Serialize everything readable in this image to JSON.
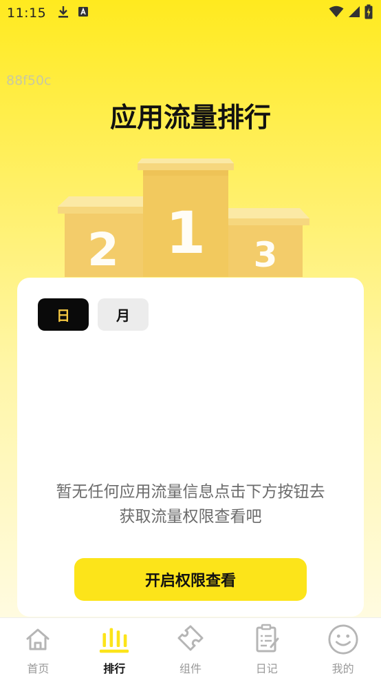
{
  "status_bar": {
    "time": "11:15",
    "icons_left": [
      "download-icon",
      "app-notification-icon"
    ],
    "icons_right": [
      "wifi-icon",
      "signal-icon",
      "battery-charging-icon"
    ]
  },
  "hash_label": "88f50c",
  "page_title": "应用流量排行",
  "podium": {
    "first": "1",
    "second": "2",
    "third": "3"
  },
  "tabs": [
    {
      "label": "日",
      "selected": true
    },
    {
      "label": "月",
      "selected": false
    }
  ],
  "empty_message_line1": "暂无任何应用流量信息点击下方按钮去",
  "empty_message_line2": "获取流量权限查看吧",
  "open_button_label": "开启权限查看",
  "nav": {
    "items": [
      {
        "label": "首页",
        "icon": "home-icon",
        "active": false
      },
      {
        "label": "排行",
        "icon": "rank-bars-icon",
        "active": true
      },
      {
        "label": "组件",
        "icon": "puzzle-icon",
        "active": false
      },
      {
        "label": "日记",
        "icon": "diary-icon",
        "active": false
      },
      {
        "label": "我的",
        "icon": "smiley-icon",
        "active": false
      }
    ]
  },
  "colors": {
    "accent_yellow": "#fce41a",
    "active_tab_bg": "#0a0a0a",
    "active_tab_text": "#f5c842"
  }
}
